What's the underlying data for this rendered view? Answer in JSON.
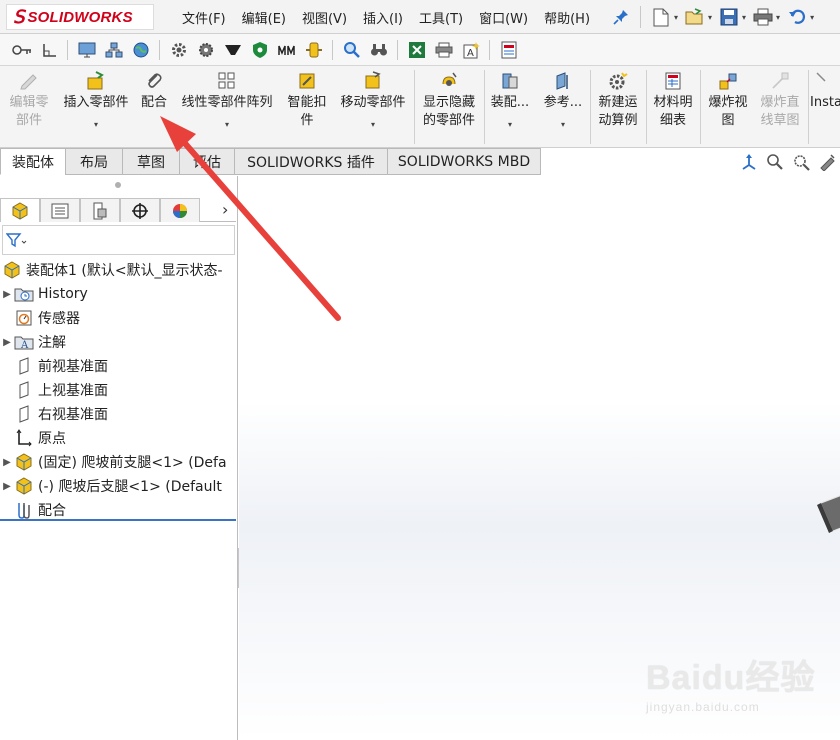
{
  "app": {
    "logo_text": "SOLIDWORKS",
    "menus": [
      "文件(F)",
      "编辑(E)",
      "视图(V)",
      "插入(I)",
      "工具(T)",
      "窗口(W)",
      "帮助(H)"
    ]
  },
  "command_manager": {
    "edit_component": "编辑零\n部件",
    "insert_component": "插入零部件",
    "mate": "配合",
    "linear_pattern": "线性零部件阵列",
    "smart_fasteners": "智能扣\n件",
    "move_component": "移动零部件",
    "show_hidden": "显示隐藏\n的零部件",
    "assembly_features": "装配...",
    "reference": "参考...",
    "new_motion_study": "新建运\n动算例",
    "bom": "材料明\n细表",
    "exploded_view": "爆炸视\n图",
    "explode_line": "爆炸直\n线草图",
    "instant3d": "Insta"
  },
  "tabs": [
    "装配体",
    "布局",
    "草图",
    "评估",
    "SOLIDWORKS 插件",
    "SOLIDWORKS MBD"
  ],
  "tree": {
    "root": "装配体1 (默认<默认_显示状态-",
    "items": [
      {
        "label": "History",
        "toggle": "▶"
      },
      {
        "label": "传感器",
        "toggle": ""
      },
      {
        "label": "注解",
        "toggle": "▶"
      },
      {
        "label": "前视基准面",
        "toggle": ""
      },
      {
        "label": "上视基准面",
        "toggle": ""
      },
      {
        "label": "右视基准面",
        "toggle": ""
      },
      {
        "label": "原点",
        "toggle": ""
      },
      {
        "label": "(固定) 爬坡前支腿<1> (Defa",
        "toggle": "▶"
      },
      {
        "label": "(-) 爬坡后支腿<1> (Default",
        "toggle": "▶"
      },
      {
        "label": "配合",
        "toggle": ""
      }
    ]
  },
  "watermark": {
    "main": "Baidu经验",
    "sub": "jingyan.baidu.com"
  },
  "colors": {
    "brand_red": "#d0021b",
    "selection_blue": "#3a73c4",
    "annotation_arrow": "#e8403a"
  }
}
